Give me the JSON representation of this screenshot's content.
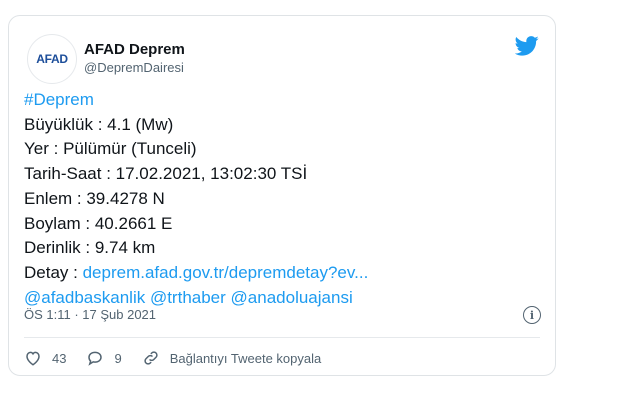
{
  "tweet": {
    "logo_text_left": "AFAD",
    "display_name": "AFAD Deprem",
    "handle": "@DepremDairesi",
    "hashtag": "#Deprem",
    "lines": {
      "buyukluk": "Büyüklük : 4.1 (Mw)",
      "yer": "Yer : Pülümür (Tunceli)",
      "tarih": "Tarih-Saat : 17.02.2021, 13:02:30 TSİ",
      "enlem": "Enlem : 39.4278 N",
      "boylam": "Boylam : 40.2661 E",
      "derinlik": "Derinlik : 9.74 km"
    },
    "detay_label": "Detay : ",
    "detay_link": "deprem.afad.gov.tr/depremdetay?ev...",
    "mentions": [
      "@afadbaskanlik",
      "@trthaber",
      "@anadoluajansi"
    ],
    "timestamp": "ÖS 1:11 · 17 Şub 2021",
    "likes": "43",
    "replies": "9",
    "copy_link": "Bağlantıyı Tweete kopyala"
  },
  "icons": [
    "twitter-bird-icon",
    "info-icon",
    "heart-icon",
    "reply-icon",
    "link-icon"
  ],
  "colors": {
    "link": "#1d9bf0",
    "muted": "#536471",
    "brand_blue": "#1d4e9a",
    "brand_red": "#e4342b"
  }
}
